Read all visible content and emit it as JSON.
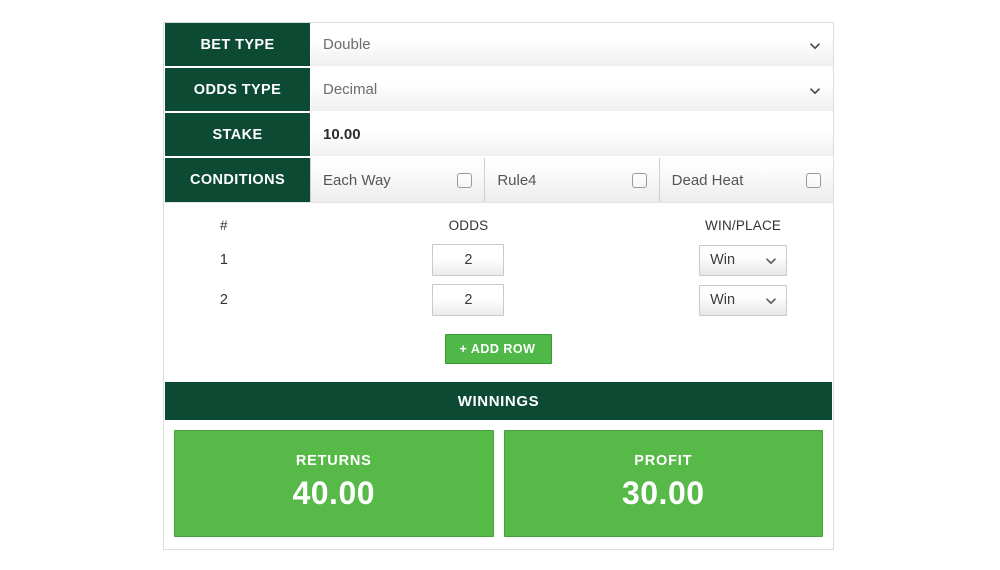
{
  "fields": {
    "bet_type": {
      "label": "BET TYPE",
      "value": "Double",
      "icon": "chevron-down-icon"
    },
    "odds_type": {
      "label": "ODDS TYPE",
      "value": "Decimal",
      "icon": "chevron-down-icon"
    },
    "stake": {
      "label": "STAKE",
      "value": "10.00",
      "placeholder": "Stake"
    }
  },
  "conditions": {
    "label": "CONDITIONS",
    "items": [
      {
        "label": "Each Way",
        "checked": false
      },
      {
        "label": "Rule4",
        "checked": false
      },
      {
        "label": "Dead Heat",
        "checked": false
      }
    ]
  },
  "legs": {
    "headers": {
      "num": "#",
      "odds": "ODDS",
      "win_place": "WIN/PLACE"
    },
    "rows": [
      {
        "num": "1",
        "odds": "2",
        "win_place": "Win"
      },
      {
        "num": "2",
        "odds": "2",
        "win_place": "Win"
      }
    ],
    "add_row_label": "+ ADD ROW"
  },
  "winnings": {
    "title": "WINNINGS",
    "cards": [
      {
        "title": "RETURNS",
        "value": "40.00"
      },
      {
        "title": "PROFIT",
        "value": "30.00"
      }
    ]
  },
  "colors": {
    "dark_green": "#0d4a34",
    "bright_green": "#56b948",
    "button_green": "#4fb848"
  }
}
